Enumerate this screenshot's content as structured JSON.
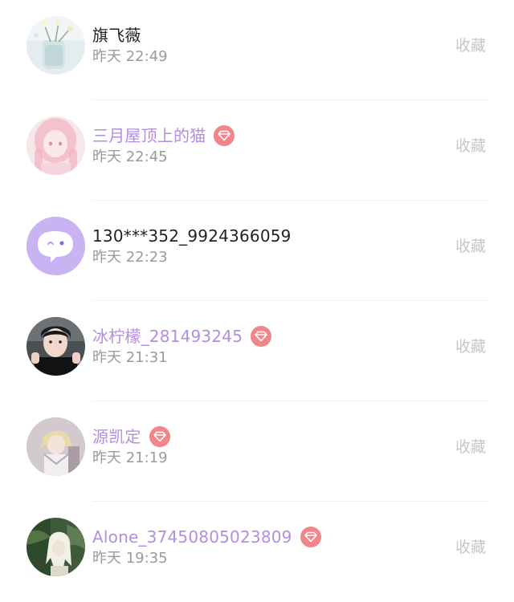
{
  "users": [
    {
      "name": "旗飞薇",
      "time": "昨天 22:49",
      "vip": false,
      "action": "收藏",
      "avatar": "flower-vase-photo"
    },
    {
      "name": "三月屋顶上的猫",
      "time": "昨天 22:45",
      "vip": true,
      "action": "收藏",
      "avatar": "pink-anime-girl"
    },
    {
      "name": "130***352_9924366059",
      "time": "昨天 22:23",
      "vip": false,
      "action": "收藏",
      "avatar": "default-chat-bubble"
    },
    {
      "name": "冰柠檬_281493245",
      "time": "昨天 21:31",
      "vip": true,
      "action": "收藏",
      "avatar": "boy-portrait-photo"
    },
    {
      "name": "源凯定",
      "time": "昨天 21:19",
      "vip": true,
      "action": "收藏",
      "avatar": "anime-character"
    },
    {
      "name": "Alone_37450805023809",
      "time": "昨天 19:35",
      "vip": true,
      "action": "收藏",
      "avatar": "green-forest-figure"
    }
  ],
  "colors": {
    "vip_name": "#b38ee0",
    "normal_name": "#222222",
    "time": "#9a9a9f",
    "action": "#c6c6cb",
    "vip_badge": "#f0868a",
    "default_avatar_bg": "#c9b3f2"
  }
}
